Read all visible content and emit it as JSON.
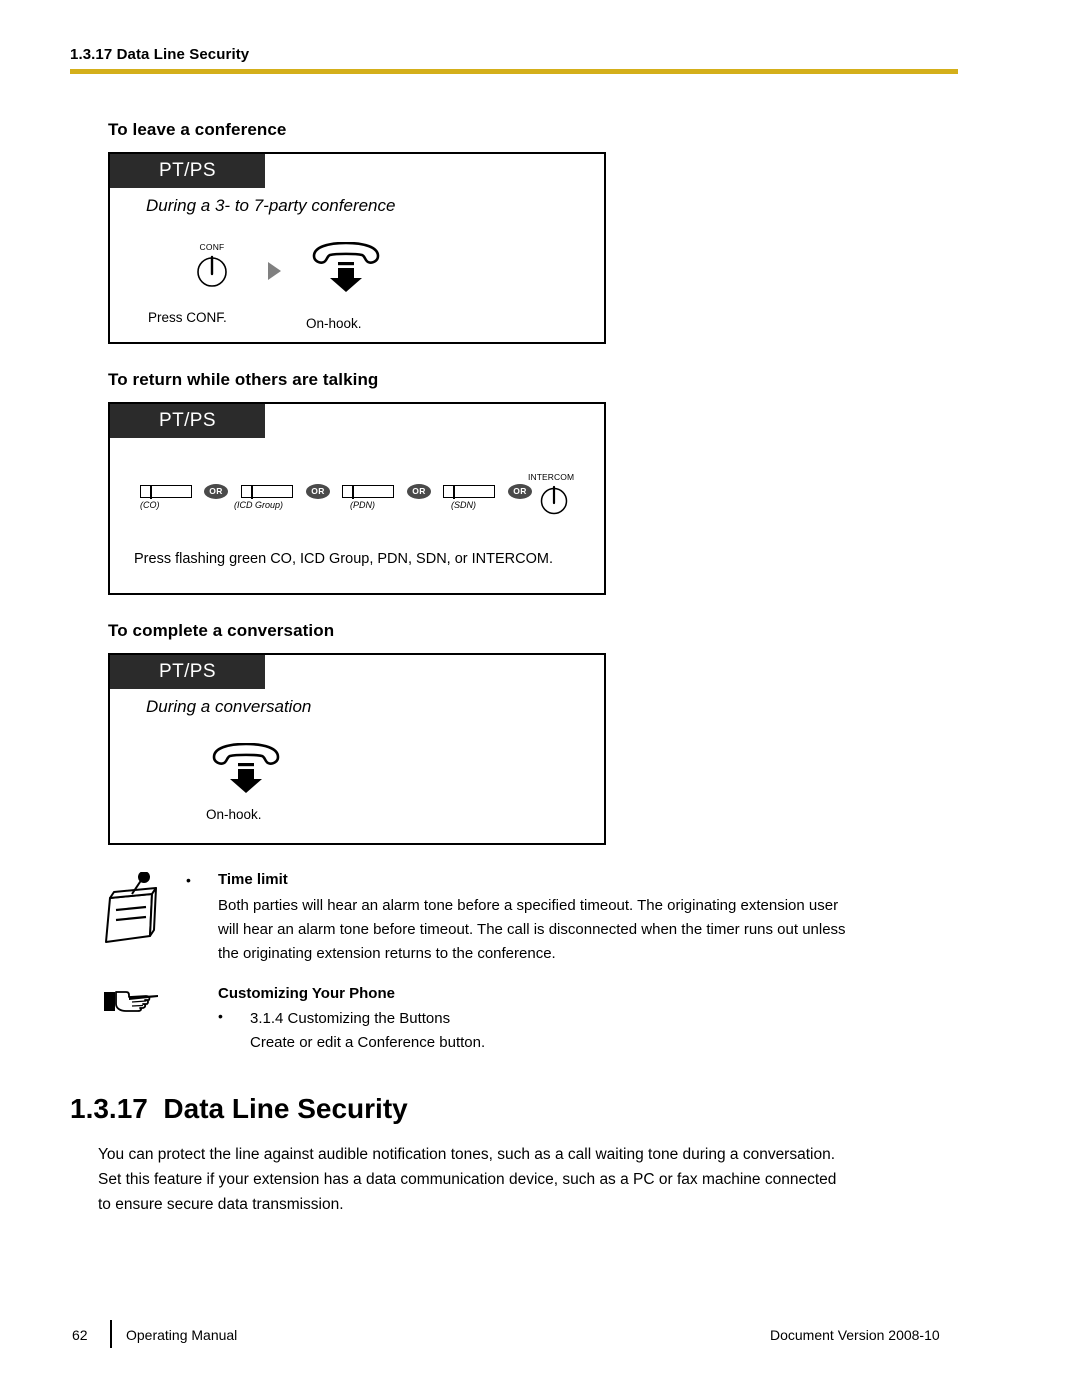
{
  "header": {
    "running_head": "1.3.17 Data Line Security",
    "rule_color": "#d4af1a"
  },
  "procedures": [
    {
      "heading": "To leave a conference",
      "badge": "PT/PS",
      "condition": "During a 3- to 7-party conference",
      "steps": [
        {
          "icon": "conf-button-icon",
          "icon_label": "CONF",
          "caption": "Press CONF."
        },
        {
          "icon": "on-hook-handset-icon",
          "icon_label": "",
          "caption": "On-hook."
        }
      ],
      "connector": "arrow-right-icon"
    },
    {
      "heading": "To return while others are talking",
      "badge": "PT/PS",
      "condition": "",
      "buttons": [
        {
          "glyph": "flexible-button-icon",
          "label": "(CO)"
        },
        {
          "glyph": "flexible-button-icon",
          "label": "(ICD Group)"
        },
        {
          "glyph": "flexible-button-icon",
          "label": "(PDN)"
        },
        {
          "glyph": "flexible-button-icon",
          "label": "(SDN)"
        },
        {
          "glyph": "intercom-button-icon",
          "label": "INTERCOM"
        }
      ],
      "separator_label": "OR",
      "sentence": "Press flashing green CO, ICD Group, PDN, SDN, or INTERCOM."
    },
    {
      "heading": "To complete a conversation",
      "badge": "PT/PS",
      "condition": "During a conversation",
      "steps": [
        {
          "icon": "on-hook-handset-icon",
          "icon_label": "",
          "caption": "On-hook."
        }
      ]
    }
  ],
  "notes": [
    {
      "icon": "note-pad-icon",
      "bullet": "•",
      "title": "Time limit",
      "lines": [
        "Both parties will hear an alarm tone before a specified timeout. The originating extension user",
        "will hear an alarm tone before timeout. The call is disconnected when the timer runs out unless",
        "the originating extension returns to the conference."
      ]
    },
    {
      "icon": "pointing-hand-icon",
      "bullet": "•",
      "title": "Customizing Your Phone",
      "lines": [
        "3.1.4  Customizing the Buttons",
        "Create or edit a Conference button."
      ]
    }
  ],
  "section": {
    "number": "1.3.17",
    "title": "Data Line Security",
    "paragraph_lines": [
      "You can protect the line against audible notification tones, such as a call waiting tone during a conversation.",
      "Set this feature if your extension has a data communication device, such as a PC or fax machine connected",
      "to ensure secure data transmission."
    ]
  },
  "footer": {
    "page_number": "62",
    "manual_name": "Operating Manual",
    "document_version": "Document Version  2008-10"
  }
}
